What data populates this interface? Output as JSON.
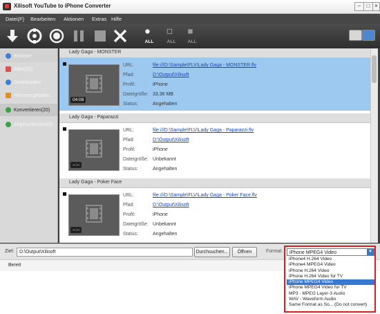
{
  "window": {
    "title": "Xilisoft YouTube to iPhone Converter"
  },
  "menu": [
    "Datei(F)",
    "Bearbeiten",
    "Aktionen",
    "Extras",
    "Hilfe"
  ],
  "toolbar": {
    "all_label": "ALL"
  },
  "sidebar": {
    "items": [
      {
        "label": "Browser",
        "icon": "globe-icon",
        "color": "#3d7fd6"
      },
      {
        "label": "Alles(22)",
        "icon": "folder-icon",
        "color": "#d9534f"
      },
      {
        "label": "Downloaden",
        "icon": "download-icon",
        "color": "#3d7fd6"
      },
      {
        "label": "Heruntergeladen",
        "icon": "downloaded-icon",
        "color": "#e08e2b"
      },
      {
        "label": "Konvertieren(20)",
        "icon": "convert-icon",
        "color": "#3aa346"
      },
      {
        "label": "Abgeschlossen(2)",
        "icon": "done-icon",
        "color": "#3aa346"
      }
    ]
  },
  "labels": {
    "url": "URL:",
    "pfad": "Pfad:",
    "profil": "Profil:",
    "size": "Dateigröße:",
    "status": "Status:"
  },
  "items": [
    {
      "title": "Lady Gaga - MONSTER",
      "url": "file:///D:\\Sample\\FLV\\Lady Gaga - MONSTER.flv",
      "pfad": "D:\\Output\\Xilisoft",
      "profil": "iPhone",
      "size": "33.36 MB",
      "status": "Angehalten",
      "duration": "04:08"
    },
    {
      "title": "Lady Gaga - Paparazzi",
      "url": "file:///D:\\Sample\\FLV\\Lady Gaga - Paparazzi.flv",
      "pfad": "D:\\Output\\Xilisoft",
      "profil": "iPhone",
      "size": "Unbekannt",
      "status": "Angehalten",
      "duration": "--:--"
    },
    {
      "title": "Lady Gaga - Poker Face",
      "url": "file:///D:\\Sample\\FLV\\Lady Gaga - Poker Face.flv",
      "pfad": "D:\\Output\\Xilisoft",
      "profil": "iPhone",
      "size": "Unbekannt",
      "status": "Angehalten",
      "duration": "--:--"
    }
  ],
  "bottom": {
    "ziel_label": "Ziel:",
    "path": "D:\\Output\\Xilisoft",
    "browse": "Durchsuchen...",
    "open": "Öffnen",
    "format_label": "Format:"
  },
  "status": {
    "text": "Bereit"
  },
  "format": {
    "selected": "iPhone MPEG4 Video",
    "options": [
      "iPhone4 H.264 Video",
      "iPhone4 MPEG4 Video",
      "iPhone H.264 Video",
      "iPhone H.264 Video for TV",
      "iPhone MPEG4 Video",
      "iPhone MPEG4 Video for TV",
      "MP3 - MPEG Layer-3 Audio",
      "WAV - Waveform Audio",
      "Same Format as So... (Do not convert)"
    ]
  },
  "colors": {
    "accent": "#e01b1b",
    "selection": "#3778d4",
    "item_selected": "#9dc8ef"
  }
}
